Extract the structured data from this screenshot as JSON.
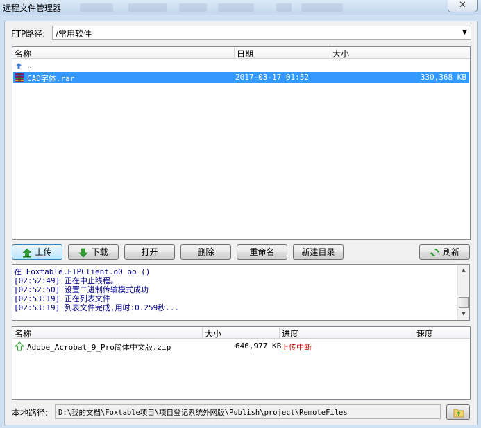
{
  "window": {
    "title": "远程文件管理器",
    "close_glyph": "✕"
  },
  "ftp_path": {
    "label": "FTP路径:",
    "value": "/常用软件",
    "dropdown_glyph": "▼"
  },
  "remote_list": {
    "columns": [
      "名称",
      "日期",
      "大小"
    ],
    "parent_row": {
      "name": ".."
    },
    "rows": [
      {
        "name": "CAD字体.rar",
        "date": "2017-03-17 01:52",
        "size": "330,368 KB",
        "selected": true
      }
    ]
  },
  "toolbar": {
    "upload": "上传",
    "download": "下载",
    "open": "打开",
    "delete": "删除",
    "rename": "重命名",
    "new_dir": "新建目录",
    "refresh": "刷新"
  },
  "log": {
    "lines": [
      "   在 Foxtable.FTPClient.o0  oo       ()",
      "[02:52:49] 正在中止线程。",
      "[02:52:50] 设置二进制传输模式成功",
      "[02:53:19] 正在列表文件",
      "[02:53:19] 列表文件完成,用时:0.259秒..."
    ]
  },
  "transfer_list": {
    "columns": [
      "名称",
      "大小",
      "进度",
      "速度"
    ],
    "rows": [
      {
        "name": "Adobe_Acrobat_9_Pro简体中文版.zip",
        "size": "646,977 KB",
        "progress": "上传中断",
        "speed": ""
      }
    ]
  },
  "local_path": {
    "label": "本地路径:",
    "value": "D:\\我的文档\\Foxtable项目\\项目登记系统外网版\\Publish\\project\\RemoteFiles"
  },
  "colors": {
    "selection": "#3399ff",
    "log_text": "#00008b",
    "error_text": "#cc0000",
    "window_bg": "#f0f0f0"
  },
  "icons": {
    "parent_dir": "up-arrow-icon",
    "archive_file": "rar-archive-icon",
    "upload": "upload-arrow-icon",
    "download": "download-arrow-icon",
    "refresh": "refresh-icon",
    "transfer_upload": "upload-outline-arrow-icon",
    "folder_open": "folder-icon"
  }
}
